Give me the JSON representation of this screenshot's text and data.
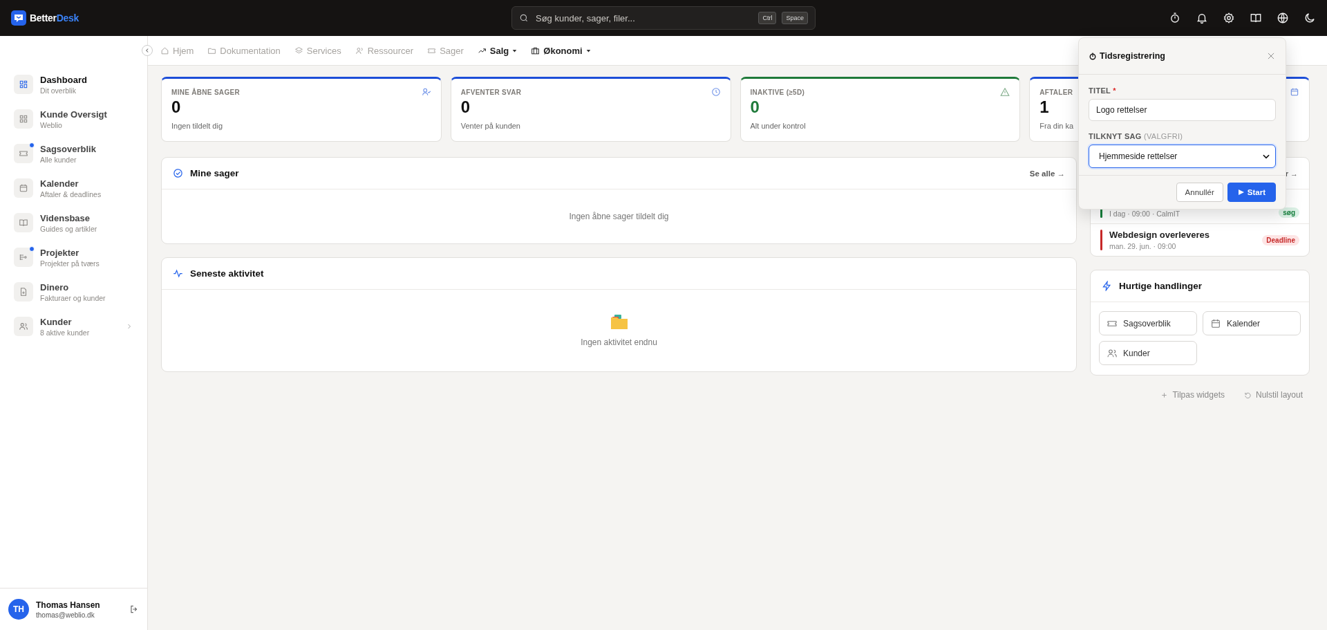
{
  "topbar": {
    "brand": {
      "text": "Better",
      "accent": "Desk"
    },
    "search": {
      "placeholder": "Søg kunder, sager, filer...",
      "shortcut": [
        "Ctrl",
        "Space"
      ]
    }
  },
  "sidebar": {
    "items": [
      {
        "title": "Dashboard",
        "subtitle": "Dit overblik",
        "selected": true,
        "notification": false,
        "expandable": false
      },
      {
        "title": "Kunde Oversigt",
        "subtitle": "Weblio",
        "selected": false,
        "notification": false,
        "expandable": false
      },
      {
        "title": "Sagsoverblik",
        "subtitle": "Alle kunder",
        "selected": false,
        "notification": true,
        "expandable": false
      },
      {
        "title": "Kalender",
        "subtitle": "Aftaler & deadlines",
        "selected": false,
        "notification": false,
        "expandable": false
      },
      {
        "title": "Vidensbase",
        "subtitle": "Guides og artikler",
        "selected": false,
        "notification": false,
        "expandable": false
      },
      {
        "title": "Projekter",
        "subtitle": "Projekter på tværs",
        "selected": false,
        "notification": true,
        "expandable": false
      },
      {
        "title": "Dinero",
        "subtitle": "Fakturaer og kunder",
        "selected": false,
        "notification": false,
        "expandable": false
      },
      {
        "title": "Kunder",
        "subtitle": "8 aktive kunder",
        "selected": false,
        "notification": false,
        "expandable": true
      }
    ],
    "user": {
      "initials": "TH",
      "name": "Thomas Hansen",
      "email": "thomas@weblio.dk"
    }
  },
  "nav": [
    {
      "label": "Hjem",
      "disabled": true,
      "dropdown": false
    },
    {
      "label": "Dokumentation",
      "disabled": true,
      "dropdown": false
    },
    {
      "label": "Services",
      "disabled": true,
      "dropdown": false
    },
    {
      "label": "Ressourcer",
      "disabled": true,
      "dropdown": false
    },
    {
      "label": "Sager",
      "disabled": true,
      "dropdown": false
    },
    {
      "label": "Salg",
      "disabled": false,
      "dropdown": true
    },
    {
      "label": "Økonomi",
      "disabled": false,
      "dropdown": true
    }
  ],
  "stats": [
    {
      "label": "MINE ÅBNE SAGER",
      "value": "0",
      "caption": "Ingen tildelt dig",
      "kind": "default"
    },
    {
      "label": "AFVENTER SVAR",
      "value": "0",
      "caption": "Venter på kunden",
      "kind": "default"
    },
    {
      "label": "INAKTIVE (≥5D)",
      "value": "0",
      "caption": "Alt under kontrol",
      "kind": "success"
    },
    {
      "label": "AFTALER",
      "value": "1",
      "caption": "Fra din ka",
      "kind": "default"
    }
  ],
  "my_cases": {
    "title": "Mine sager",
    "link": "Se alle →",
    "empty": "Ingen åbne sager tildelt dig"
  },
  "activity": {
    "title": "Seneste aktivitet",
    "empty": "Ingen aktivitet endnu"
  },
  "upcoming": {
    "link": "r →",
    "items": [
      {
        "meta": "I dag · 09:00 · CalmIT",
        "tag": "søg",
        "kind": "meeting",
        "color": "#15803d"
      },
      {
        "title": "Webdesign overleveres",
        "meta": "man. 29. jun. · 09:00",
        "tag": "Deadline",
        "kind": "deadline",
        "color": "#c62828"
      }
    ]
  },
  "quick_actions": {
    "title": "Hurtige handlinger",
    "buttons": [
      "Sagsoverblik",
      "Kalender",
      "Kunder"
    ]
  },
  "footer_links": [
    "Tilpas widgets",
    "Nulstil layout"
  ],
  "timer_dialog": {
    "title": "Tidsregistrering",
    "fields": [
      {
        "kind": "text",
        "label": "TITEL",
        "required_mark": "*",
        "focused": false,
        "value": "Logo rettelser"
      },
      {
        "kind": "select",
        "label": "TILKNYT SAG",
        "hint": "(VALGFRI)",
        "focused": true,
        "value": "Hjemmeside rettelser"
      }
    ],
    "buttons": [
      {
        "label": "Annullér",
        "primary": false
      },
      {
        "label": "Start",
        "primary": true
      }
    ]
  }
}
